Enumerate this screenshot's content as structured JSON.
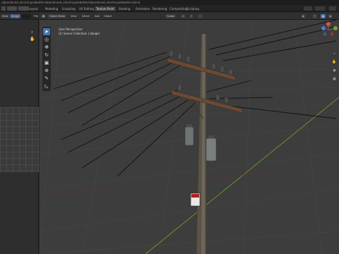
{
  "window": {
    "title_path": "/abandoned_electricpolebetter/abandoned_electricpolebetter/abandoned_electricpolebetter.blend"
  },
  "workspace_tabs": [
    {
      "label": "Layout",
      "active": false
    },
    {
      "label": "Modeling",
      "active": false
    },
    {
      "label": "Sculpting",
      "active": false
    },
    {
      "label": "UV Editing",
      "active": false
    },
    {
      "label": "Texture Paint",
      "active": true
    },
    {
      "label": "Shading",
      "active": false
    },
    {
      "label": "Animation",
      "active": false
    },
    {
      "label": "Rendering",
      "active": false
    },
    {
      "label": "Compositing",
      "active": false
    },
    {
      "label": "Scripting",
      "active": false
    }
  ],
  "left_editor": {
    "header_buttons": {
      "view": "View",
      "image": "Image",
      "file": "File"
    }
  },
  "viewport_header": {
    "mode": "Object Mode",
    "menus": [
      "View",
      "Select",
      "Add",
      "Object"
    ],
    "orientation": "Global"
  },
  "viewport": {
    "view_name": "User Perspective",
    "collection_info": "(1) Scene Collection | danger"
  },
  "tools": [
    {
      "icon": "select-cursor-icon",
      "glyph": "➤",
      "active": true
    },
    {
      "icon": "cursor-3d-icon",
      "glyph": "◎",
      "active": false
    },
    {
      "icon": "move-icon",
      "glyph": "✥",
      "active": false
    },
    {
      "icon": "rotate-icon",
      "glyph": "↻",
      "active": false
    },
    {
      "icon": "scale-icon",
      "glyph": "▣",
      "active": false
    },
    {
      "icon": "transform-icon",
      "glyph": "⊕",
      "active": false
    },
    {
      "icon": "annotate-icon",
      "glyph": "✎",
      "active": false
    },
    {
      "icon": "measure-icon",
      "glyph": "◺",
      "active": false
    }
  ],
  "colors": {
    "accent": "#4772b3",
    "axis_x": "#9b3a3a",
    "axis_y": "#6f8f2a",
    "wood": "#6b4a34",
    "pole": "#5a5347"
  }
}
